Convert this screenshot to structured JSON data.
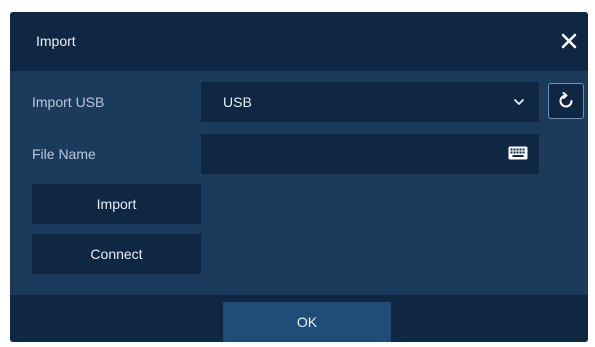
{
  "dialog": {
    "title": "Import",
    "close_icon": "close-icon"
  },
  "import_usb": {
    "label": "Import USB",
    "selected": "USB",
    "dropdown_icon": "chevron-down-icon",
    "refresh_icon": "refresh-icon"
  },
  "file_name": {
    "label": "File Name",
    "value": "",
    "keyboard_icon": "keyboard-icon"
  },
  "buttons": {
    "import_label": "Import",
    "connect_label": "Connect",
    "ok_label": "OK"
  },
  "colors": {
    "dialog_bg": "#1c3a5c",
    "panel_dark": "#0f2742",
    "ok_button": "#1f4d78",
    "label_text": "#b9c9d9",
    "text": "#e9eef4"
  }
}
